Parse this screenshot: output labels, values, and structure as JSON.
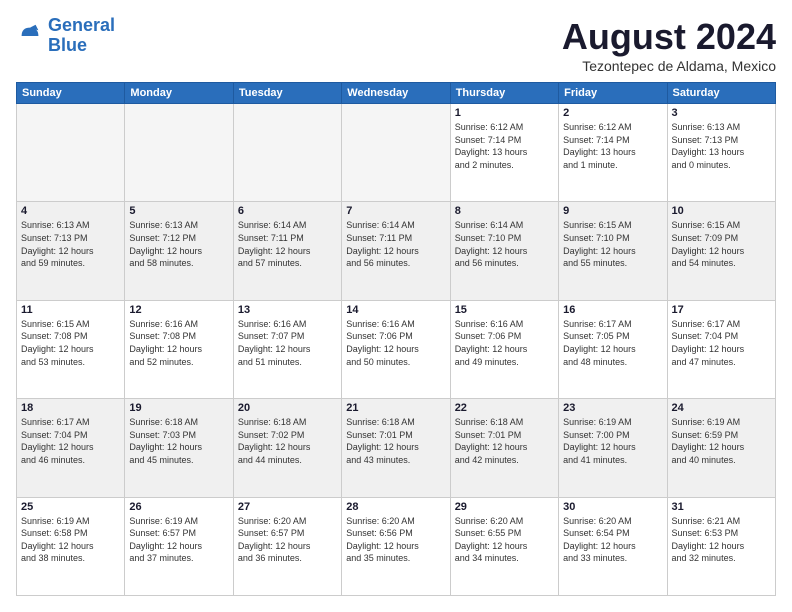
{
  "logo": {
    "line1": "General",
    "line2": "Blue"
  },
  "header": {
    "month": "August 2024",
    "location": "Tezontepec de Aldama, Mexico"
  },
  "weekdays": [
    "Sunday",
    "Monday",
    "Tuesday",
    "Wednesday",
    "Thursday",
    "Friday",
    "Saturday"
  ],
  "weeks": [
    [
      {
        "day": "",
        "info": ""
      },
      {
        "day": "",
        "info": ""
      },
      {
        "day": "",
        "info": ""
      },
      {
        "day": "",
        "info": ""
      },
      {
        "day": "1",
        "info": "Sunrise: 6:12 AM\nSunset: 7:14 PM\nDaylight: 13 hours\nand 2 minutes."
      },
      {
        "day": "2",
        "info": "Sunrise: 6:12 AM\nSunset: 7:14 PM\nDaylight: 13 hours\nand 1 minute."
      },
      {
        "day": "3",
        "info": "Sunrise: 6:13 AM\nSunset: 7:13 PM\nDaylight: 13 hours\nand 0 minutes."
      }
    ],
    [
      {
        "day": "4",
        "info": "Sunrise: 6:13 AM\nSunset: 7:13 PM\nDaylight: 12 hours\nand 59 minutes."
      },
      {
        "day": "5",
        "info": "Sunrise: 6:13 AM\nSunset: 7:12 PM\nDaylight: 12 hours\nand 58 minutes."
      },
      {
        "day": "6",
        "info": "Sunrise: 6:14 AM\nSunset: 7:11 PM\nDaylight: 12 hours\nand 57 minutes."
      },
      {
        "day": "7",
        "info": "Sunrise: 6:14 AM\nSunset: 7:11 PM\nDaylight: 12 hours\nand 56 minutes."
      },
      {
        "day": "8",
        "info": "Sunrise: 6:14 AM\nSunset: 7:10 PM\nDaylight: 12 hours\nand 56 minutes."
      },
      {
        "day": "9",
        "info": "Sunrise: 6:15 AM\nSunset: 7:10 PM\nDaylight: 12 hours\nand 55 minutes."
      },
      {
        "day": "10",
        "info": "Sunrise: 6:15 AM\nSunset: 7:09 PM\nDaylight: 12 hours\nand 54 minutes."
      }
    ],
    [
      {
        "day": "11",
        "info": "Sunrise: 6:15 AM\nSunset: 7:08 PM\nDaylight: 12 hours\nand 53 minutes."
      },
      {
        "day": "12",
        "info": "Sunrise: 6:16 AM\nSunset: 7:08 PM\nDaylight: 12 hours\nand 52 minutes."
      },
      {
        "day": "13",
        "info": "Sunrise: 6:16 AM\nSunset: 7:07 PM\nDaylight: 12 hours\nand 51 minutes."
      },
      {
        "day": "14",
        "info": "Sunrise: 6:16 AM\nSunset: 7:06 PM\nDaylight: 12 hours\nand 50 minutes."
      },
      {
        "day": "15",
        "info": "Sunrise: 6:16 AM\nSunset: 7:06 PM\nDaylight: 12 hours\nand 49 minutes."
      },
      {
        "day": "16",
        "info": "Sunrise: 6:17 AM\nSunset: 7:05 PM\nDaylight: 12 hours\nand 48 minutes."
      },
      {
        "day": "17",
        "info": "Sunrise: 6:17 AM\nSunset: 7:04 PM\nDaylight: 12 hours\nand 47 minutes."
      }
    ],
    [
      {
        "day": "18",
        "info": "Sunrise: 6:17 AM\nSunset: 7:04 PM\nDaylight: 12 hours\nand 46 minutes."
      },
      {
        "day": "19",
        "info": "Sunrise: 6:18 AM\nSunset: 7:03 PM\nDaylight: 12 hours\nand 45 minutes."
      },
      {
        "day": "20",
        "info": "Sunrise: 6:18 AM\nSunset: 7:02 PM\nDaylight: 12 hours\nand 44 minutes."
      },
      {
        "day": "21",
        "info": "Sunrise: 6:18 AM\nSunset: 7:01 PM\nDaylight: 12 hours\nand 43 minutes."
      },
      {
        "day": "22",
        "info": "Sunrise: 6:18 AM\nSunset: 7:01 PM\nDaylight: 12 hours\nand 42 minutes."
      },
      {
        "day": "23",
        "info": "Sunrise: 6:19 AM\nSunset: 7:00 PM\nDaylight: 12 hours\nand 41 minutes."
      },
      {
        "day": "24",
        "info": "Sunrise: 6:19 AM\nSunset: 6:59 PM\nDaylight: 12 hours\nand 40 minutes."
      }
    ],
    [
      {
        "day": "25",
        "info": "Sunrise: 6:19 AM\nSunset: 6:58 PM\nDaylight: 12 hours\nand 38 minutes."
      },
      {
        "day": "26",
        "info": "Sunrise: 6:19 AM\nSunset: 6:57 PM\nDaylight: 12 hours\nand 37 minutes."
      },
      {
        "day": "27",
        "info": "Sunrise: 6:20 AM\nSunset: 6:57 PM\nDaylight: 12 hours\nand 36 minutes."
      },
      {
        "day": "28",
        "info": "Sunrise: 6:20 AM\nSunset: 6:56 PM\nDaylight: 12 hours\nand 35 minutes."
      },
      {
        "day": "29",
        "info": "Sunrise: 6:20 AM\nSunset: 6:55 PM\nDaylight: 12 hours\nand 34 minutes."
      },
      {
        "day": "30",
        "info": "Sunrise: 6:20 AM\nSunset: 6:54 PM\nDaylight: 12 hours\nand 33 minutes."
      },
      {
        "day": "31",
        "info": "Sunrise: 6:21 AM\nSunset: 6:53 PM\nDaylight: 12 hours\nand 32 minutes."
      }
    ]
  ]
}
